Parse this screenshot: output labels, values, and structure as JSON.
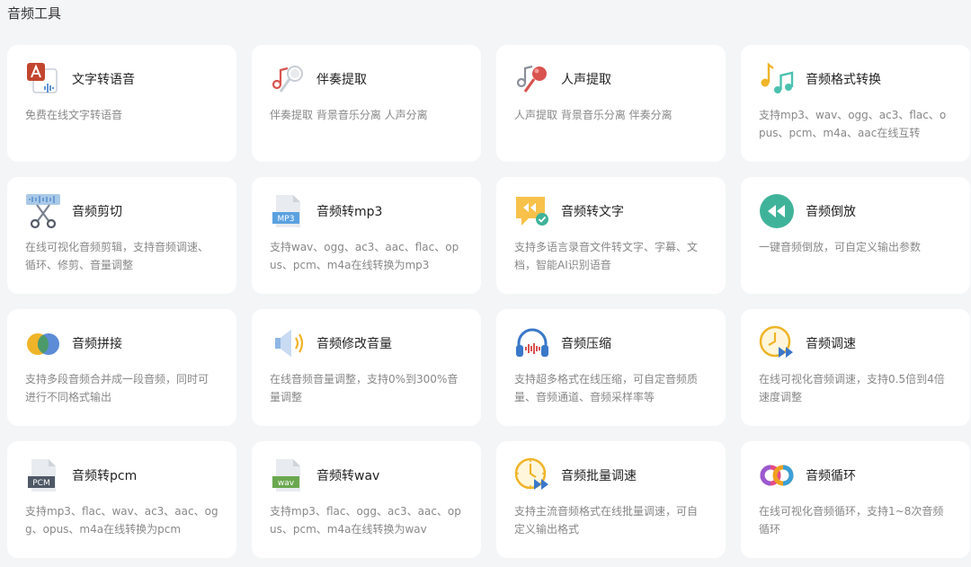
{
  "section": {
    "title": "音频工具"
  },
  "tools": [
    {
      "icon": "text-to-speech-icon",
      "title": "文字转语音",
      "desc": "免费在线文字转语音"
    },
    {
      "icon": "accompaniment-extract-icon",
      "title": "伴奏提取",
      "desc": "伴奏提取 背景音乐分离 人声分离"
    },
    {
      "icon": "vocal-extract-icon",
      "title": "人声提取",
      "desc": "人声提取 背景音乐分离 伴奏分离"
    },
    {
      "icon": "music-notes-icon",
      "title": "音频格式转换",
      "desc": "支持mp3、wav、ogg、ac3、flac、opus、pcm、m4a、aac在线互转"
    },
    {
      "icon": "scissors-icon",
      "title": "音频剪切",
      "desc": "在线可视化音频剪辑，支持音频调速、循环、修剪、音量调整"
    },
    {
      "icon": "mp3-file-icon",
      "title": "音频转mp3",
      "desc": "支持wav、ogg、ac3、aac、flac、opus、pcm、m4a在线转换为mp3"
    },
    {
      "icon": "audio-to-text-icon",
      "title": "音频转文字",
      "desc": "支持多语言录音文件转文字、字幕、文档，智能AI识别语音"
    },
    {
      "icon": "rewind-icon",
      "title": "音频倒放",
      "desc": "一键音频倒放，可自定义输出参数"
    },
    {
      "icon": "merge-circles-icon",
      "title": "音频拼接",
      "desc": "支持多段音频合并成一段音频，同时可进行不同格式输出"
    },
    {
      "icon": "speaker-icon",
      "title": "音频修改音量",
      "desc": "在线音频音量调整，支持0%到300%音量调整"
    },
    {
      "icon": "headphones-icon",
      "title": "音频压缩",
      "desc": "支持超多格式在线压缩，可自定音频质量、音频通道、音频采样率等"
    },
    {
      "icon": "speed-clock-icon",
      "title": "音频调速",
      "desc": "在线可视化音频调速，支持0.5倍到4倍速度调整"
    },
    {
      "icon": "pcm-file-icon",
      "title": "音频转pcm",
      "desc": "支持mp3、flac、wav、ac3、aac、ogg、opus、m4a在线转换为pcm"
    },
    {
      "icon": "wav-file-icon",
      "title": "音频转wav",
      "desc": "支持mp3、flac、ogg、ac3、aac、opus、pcm、m4a在线转换为wav"
    },
    {
      "icon": "batch-speed-icon",
      "title": "音频批量调速",
      "desc": "支持主流音频格式在线批量调速，可自定义输出格式"
    },
    {
      "icon": "loop-circles-icon",
      "title": "音频循环",
      "desc": "在线可视化音频循环，支持1~8次音频循环"
    }
  ],
  "icon_labels": {
    "mp3": "MP3",
    "pcm": "PCM",
    "wav": "wav"
  },
  "colors": {
    "page_bg": "#f4f5f7",
    "card_bg": "#ffffff",
    "title": "#222222",
    "desc": "#888888",
    "teal": "#3fb39a",
    "red": "#d9534f",
    "orange": "#f0a020"
  }
}
